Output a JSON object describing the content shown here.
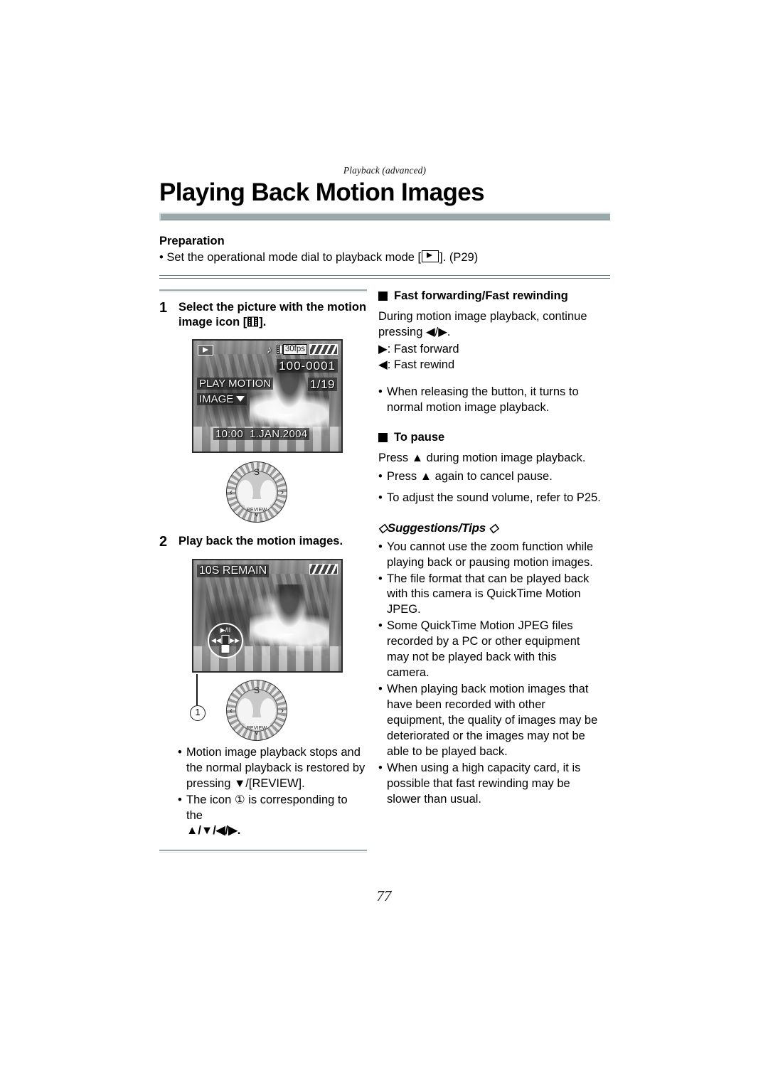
{
  "header": {
    "chapter_tag": "Playback (advanced)",
    "title": "Playing Back Motion Images"
  },
  "preparation": {
    "heading": "Preparation",
    "bullet": "Set the operational mode dial to playback mode [",
    "bullet_after": "]. (P29)",
    "playback_icon": "play-icon"
  },
  "left_column": {
    "step1": {
      "number": "1",
      "text_before": "Select the picture with the motion image icon [",
      "text_after": "].",
      "icon": "motion-image-film-icon"
    },
    "lcd1": {
      "play_icon": "play-icon",
      "audio_icon": "♪",
      "film_icon": "film-strip-icon",
      "fps": "30fps",
      "battery_icon": "battery-icon",
      "file_number": "100-0001",
      "frame_count": "1/19",
      "menu_line1": "PLAY MOTION",
      "menu_line2": "IMAGE",
      "time": "10:00",
      "date": "1.JAN.2004"
    },
    "dial1": {
      "top_label": "S",
      "left_label": "‹",
      "right_label": "›",
      "review_label": "REVIEW",
      "down_label": "˅"
    },
    "step2": {
      "number": "2",
      "text": "Play back the motion images."
    },
    "lcd2": {
      "remain": "10S REMAIN",
      "battery_icon": "battery-icon",
      "cursor_play_pause": "▶/II",
      "cursor_rewind": "◀◀",
      "cursor_forward": "▶▶",
      "cursor_stop": "stop-icon"
    },
    "callout": {
      "number": "1"
    },
    "dial2": {
      "top_label": "S",
      "left_label": "‹",
      "right_label": "›",
      "review_label": "REVIEW",
      "down_label": "˅"
    },
    "notes": [
      "Motion image playback stops and the normal playback is restored by pressing ▼/[REVIEW].",
      "The icon ① is corresponding to the"
    ],
    "notes_last_line": "▲/▼/◀/▶."
  },
  "right_column": {
    "section1": {
      "heading": "Fast forwarding/Fast rewinding",
      "paragraph": "During motion image playback, continue pressing ◀/▶.",
      "line_forward": "▶: Fast forward",
      "line_rewind": "◀: Fast rewind",
      "bullet": "When releasing the button, it turns to normal motion image playback."
    },
    "section2": {
      "heading": "To pause",
      "paragraph": "Press ▲ during motion image playback.",
      "bullets": [
        "Press ▲ again to cancel pause.",
        "To adjust the sound volume, refer to P25."
      ]
    },
    "tips": {
      "heading": "◇Suggestions/Tips ◇",
      "bullets": [
        "You cannot use the zoom function while playing back or pausing motion images.",
        "The file format that can be played back with this camera is QuickTime Motion JPEG.",
        "Some QuickTime Motion JPEG files recorded by a PC or other equipment may not be played back with this camera.",
        "When playing back motion images that have been recorded with other equipment, the quality of images may be deteriorated or the images may not be able to be played back.",
        "When using a high capacity card, it is possible that fast rewinding may be slower than usual."
      ]
    }
  },
  "footer": {
    "page_number": "77"
  },
  "colors": {
    "title_bar": "#9aa9aa",
    "rule": "#6d7b7c",
    "text": "#000000"
  }
}
